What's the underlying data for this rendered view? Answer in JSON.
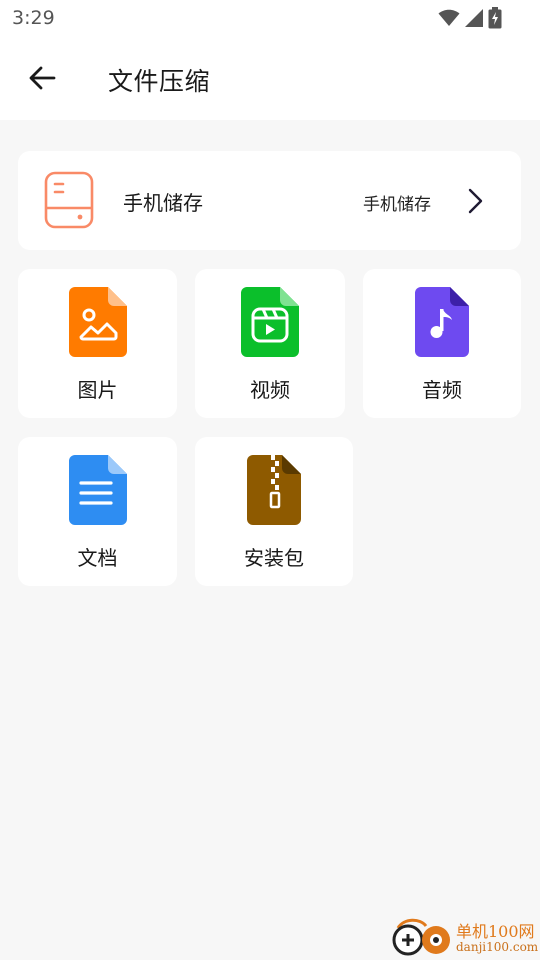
{
  "status_bar": {
    "time": "3:29",
    "icons": [
      "wifi-icon",
      "signal-icon",
      "battery-charging-icon"
    ]
  },
  "header": {
    "back_icon": "arrow-left-icon",
    "title": "文件压缩"
  },
  "storage": {
    "icon": "phone-storage-icon",
    "label": "手机储存",
    "value": "手机储存",
    "chevron_icon": "chevron-right-icon"
  },
  "categories": [
    {
      "label": "图片",
      "icon": "image-file-icon",
      "color": "#ff7b00"
    },
    {
      "label": "视频",
      "icon": "video-file-icon",
      "color": "#0bbf2b"
    },
    {
      "label": "音频",
      "icon": "audio-file-icon",
      "color": "#6e4af0"
    },
    {
      "label": "文档",
      "icon": "document-file-icon",
      "color": "#2e8df2"
    },
    {
      "label": "安装包",
      "icon": "package-file-icon",
      "color": "#8e5a00"
    }
  ],
  "watermark": {
    "title": "单机100网",
    "url": "danji100.com"
  },
  "colors": {
    "background": "#f7f7f7",
    "card": "#ffffff",
    "storage_accent": "#f98a67"
  }
}
